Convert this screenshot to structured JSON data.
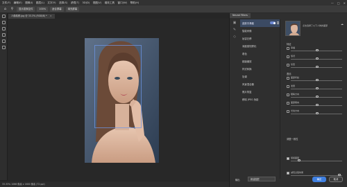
{
  "menu": [
    "文件(F)",
    "编辑(E)",
    "图像(I)",
    "图层(L)",
    "文字(Y)",
    "选择(S)",
    "滤镜(T)",
    "3D(D)",
    "视图(V)",
    "增效工具",
    "窗口(W)",
    "帮助(H)"
  ],
  "options_bar": {
    "buttons": [
      "显示变换控件",
      "100%",
      "适合屏幕",
      "填充屏幕"
    ]
  },
  "document_tab": {
    "title": "人像精修.jpg @ 33.3% (RGB/8) *"
  },
  "status_bar": {
    "text": "33.33%   1066 像素 x 1600 像素 (72 ppi)"
  },
  "neural_filters": {
    "panel_title": "Neural Filters",
    "filters": [
      {
        "label": "皮肤平滑度",
        "active": true,
        "toggle": true
      },
      {
        "label": "智能肖像"
      },
      {
        "label": "妆容迁移"
      },
      {
        "label": "深度感知雾化"
      },
      {
        "label": "着色"
      },
      {
        "label": "超级缩放"
      },
      {
        "label": "样式转换"
      },
      {
        "label": "协调"
      },
      {
        "label": "风景混合器"
      },
      {
        "label": "照片恢复"
      },
      {
        "label": "移除 JPEG 伪影"
      }
    ],
    "thumb_note": "点击选择了以下人物的面部",
    "sections": [
      {
        "title": "特征",
        "rows": [
          "幸福",
          "惊讶",
          "愤怒"
        ]
      },
      {
        "title": "表情",
        "rows": [
          "面部年龄",
          "发量",
          "眼睛方向",
          "面部朝向",
          "光线方向"
        ]
      },
      {
        "title": "调整一致性",
        "rows": [
          "保留面部",
          "减轻过强效果"
        ]
      }
    ]
  },
  "footer": {
    "output_label": "输出",
    "output_value": "新建图层",
    "ok_label": "确定",
    "cancel_label": "取消"
  },
  "colors": {
    "accent": "#3f7fe0",
    "panel_bg": "#2f2f2f",
    "canvas_bg": "#282828"
  }
}
